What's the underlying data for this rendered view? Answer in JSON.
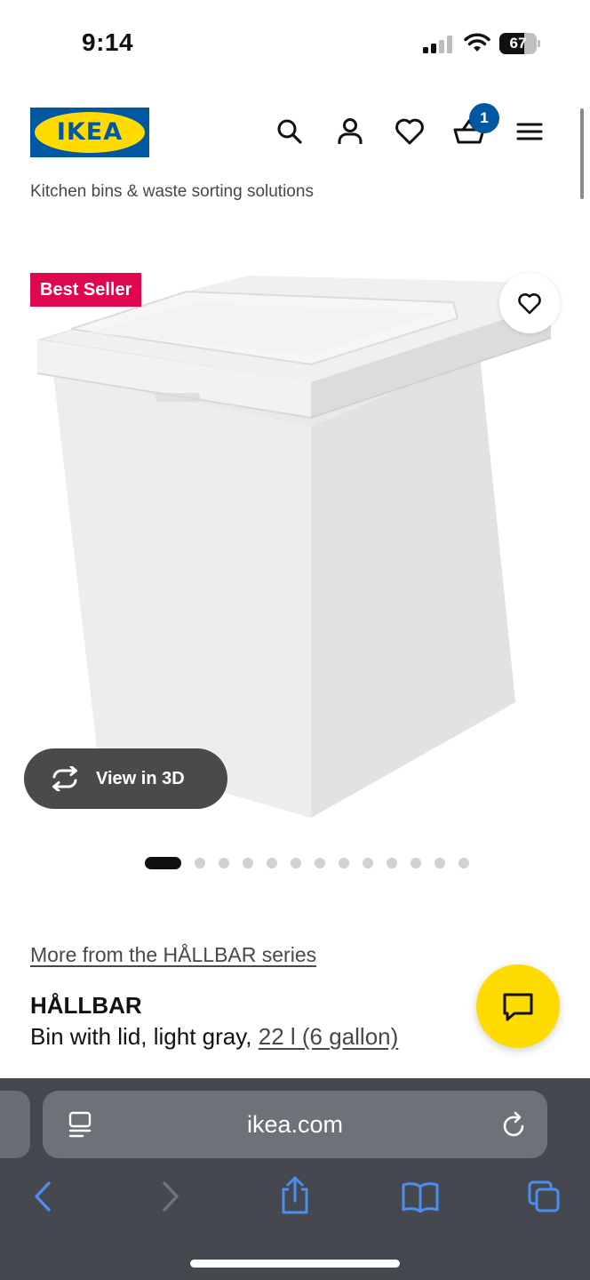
{
  "status_bar": {
    "time": "9:14",
    "battery_percent": 67,
    "battery_label": "67"
  },
  "header": {
    "logo_text": "IKEA",
    "cart_count": "1",
    "icons": [
      "search-icon",
      "account-icon",
      "heart-icon",
      "cart-icon",
      "menu-icon"
    ]
  },
  "breadcrumb": "Kitchen bins & waste sorting solutions",
  "gallery": {
    "badge": "Best Seller",
    "view_3d_label": "View in 3D",
    "image_count": 13,
    "active_index": 0
  },
  "product": {
    "series_link": "More from the HÅLLBAR series",
    "name": "HÅLLBAR",
    "description": "Bin with lid, light gray, ",
    "size_link": "22 l (6 gallon)"
  },
  "browser": {
    "url": "ikea.com"
  },
  "colors": {
    "ikea_blue": "#0058a3",
    "ikea_yellow": "#ffdb00",
    "badge_red": "#e00751",
    "safari_blue": "#4a8ef0"
  }
}
